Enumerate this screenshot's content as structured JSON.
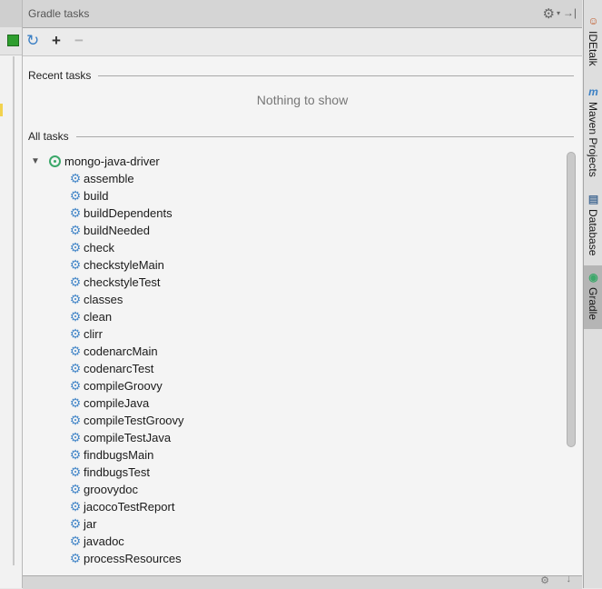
{
  "panel": {
    "title": "Gradle tasks",
    "toolbar": {
      "refresh_glyph": "↻",
      "add_glyph": "+",
      "remove_glyph": "−"
    }
  },
  "recent": {
    "header": "Recent tasks",
    "empty_text": "Nothing to show"
  },
  "all": {
    "header": "All tasks",
    "project": "mongo-java-driver",
    "tasks": [
      "assemble",
      "build",
      "buildDependents",
      "buildNeeded",
      "check",
      "checkstyleMain",
      "checkstyleTest",
      "classes",
      "clean",
      "clirr",
      "codenarcMain",
      "codenarcTest",
      "compileGroovy",
      "compileJava",
      "compileTestGroovy",
      "compileTestJava",
      "findbugsMain",
      "findbugsTest",
      "groovydoc",
      "jacocoTestReport",
      "jar",
      "javadoc",
      "processResources"
    ]
  },
  "side_tabs": [
    {
      "label": "IDEtalk",
      "icon": "person-icon"
    },
    {
      "label": "Maven Projects",
      "icon": "maven-icon"
    },
    {
      "label": "Database",
      "icon": "database-icon"
    },
    {
      "label": "Gradle",
      "icon": "gradle-icon",
      "active": true
    }
  ],
  "colors": {
    "accent": "#3a7fc4",
    "gradle_green": "#3ca86a",
    "task_gear": "#4a8ac9"
  }
}
